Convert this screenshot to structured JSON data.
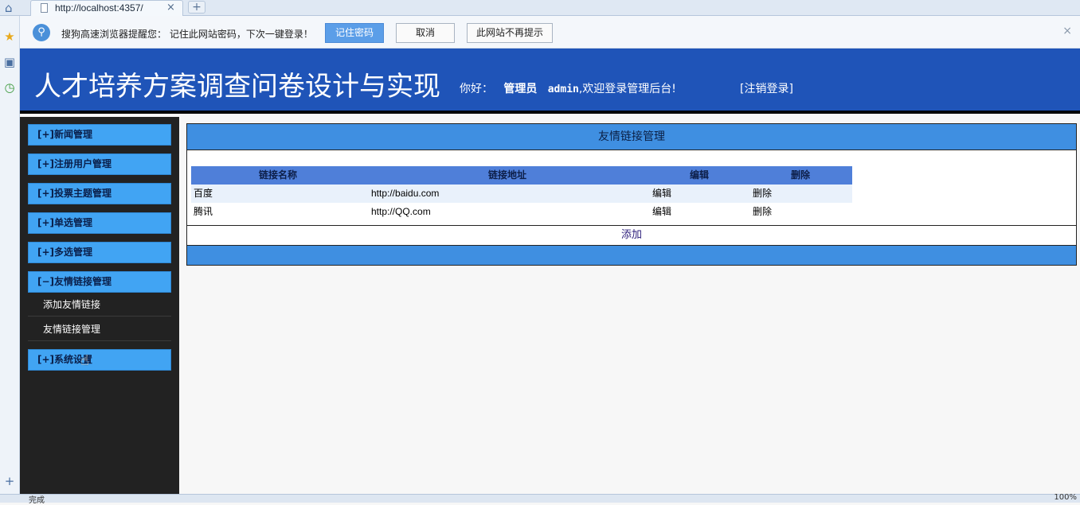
{
  "browser": {
    "tab_url": "http://localhost:4357/",
    "tab_close": "×",
    "new_tab": "+",
    "home_icon": "home-icon",
    "status_text": "完成",
    "zoom": "100%"
  },
  "notify": {
    "message": "搜狗高速浏览器提醒您： 记住此网站密码，下次一键登录！",
    "remember_label": "记住密码",
    "cancel_label": "取消",
    "never_label": "此网站不再提示",
    "close": "×"
  },
  "header": {
    "title": "人才培养方案调查问卷设计与实现",
    "greeting_prefix": "你好：",
    "role": "管理员",
    "username": "admin",
    "greeting_suffix": ",欢迎登录管理后台!",
    "logout": "[注销登录]"
  },
  "sidebar": {
    "menus": [
      {
        "label": "[+]新闻管理"
      },
      {
        "label": "[+]注册用户管理"
      },
      {
        "label": "[+]投票主题管理"
      },
      {
        "label": "[+]单选管理"
      },
      {
        "label": "[+]多选管理"
      },
      {
        "label": "[−]友情链接管理"
      },
      {
        "label": "[+]系统设置"
      }
    ],
    "submenu": [
      {
        "label": "添加友情链接"
      },
      {
        "label": "友情链接管理"
      }
    ]
  },
  "panel": {
    "title": "友情链接管理",
    "columns": [
      "链接名称",
      "链接地址",
      "编辑",
      "删除"
    ],
    "rows": [
      {
        "name": "百度",
        "url": "http://baidu.com",
        "edit": "编辑",
        "delete": "删除"
      },
      {
        "name": "腾讯",
        "url": "http://QQ.com",
        "edit": "编辑",
        "delete": "删除"
      }
    ],
    "add_label": "添加"
  }
}
